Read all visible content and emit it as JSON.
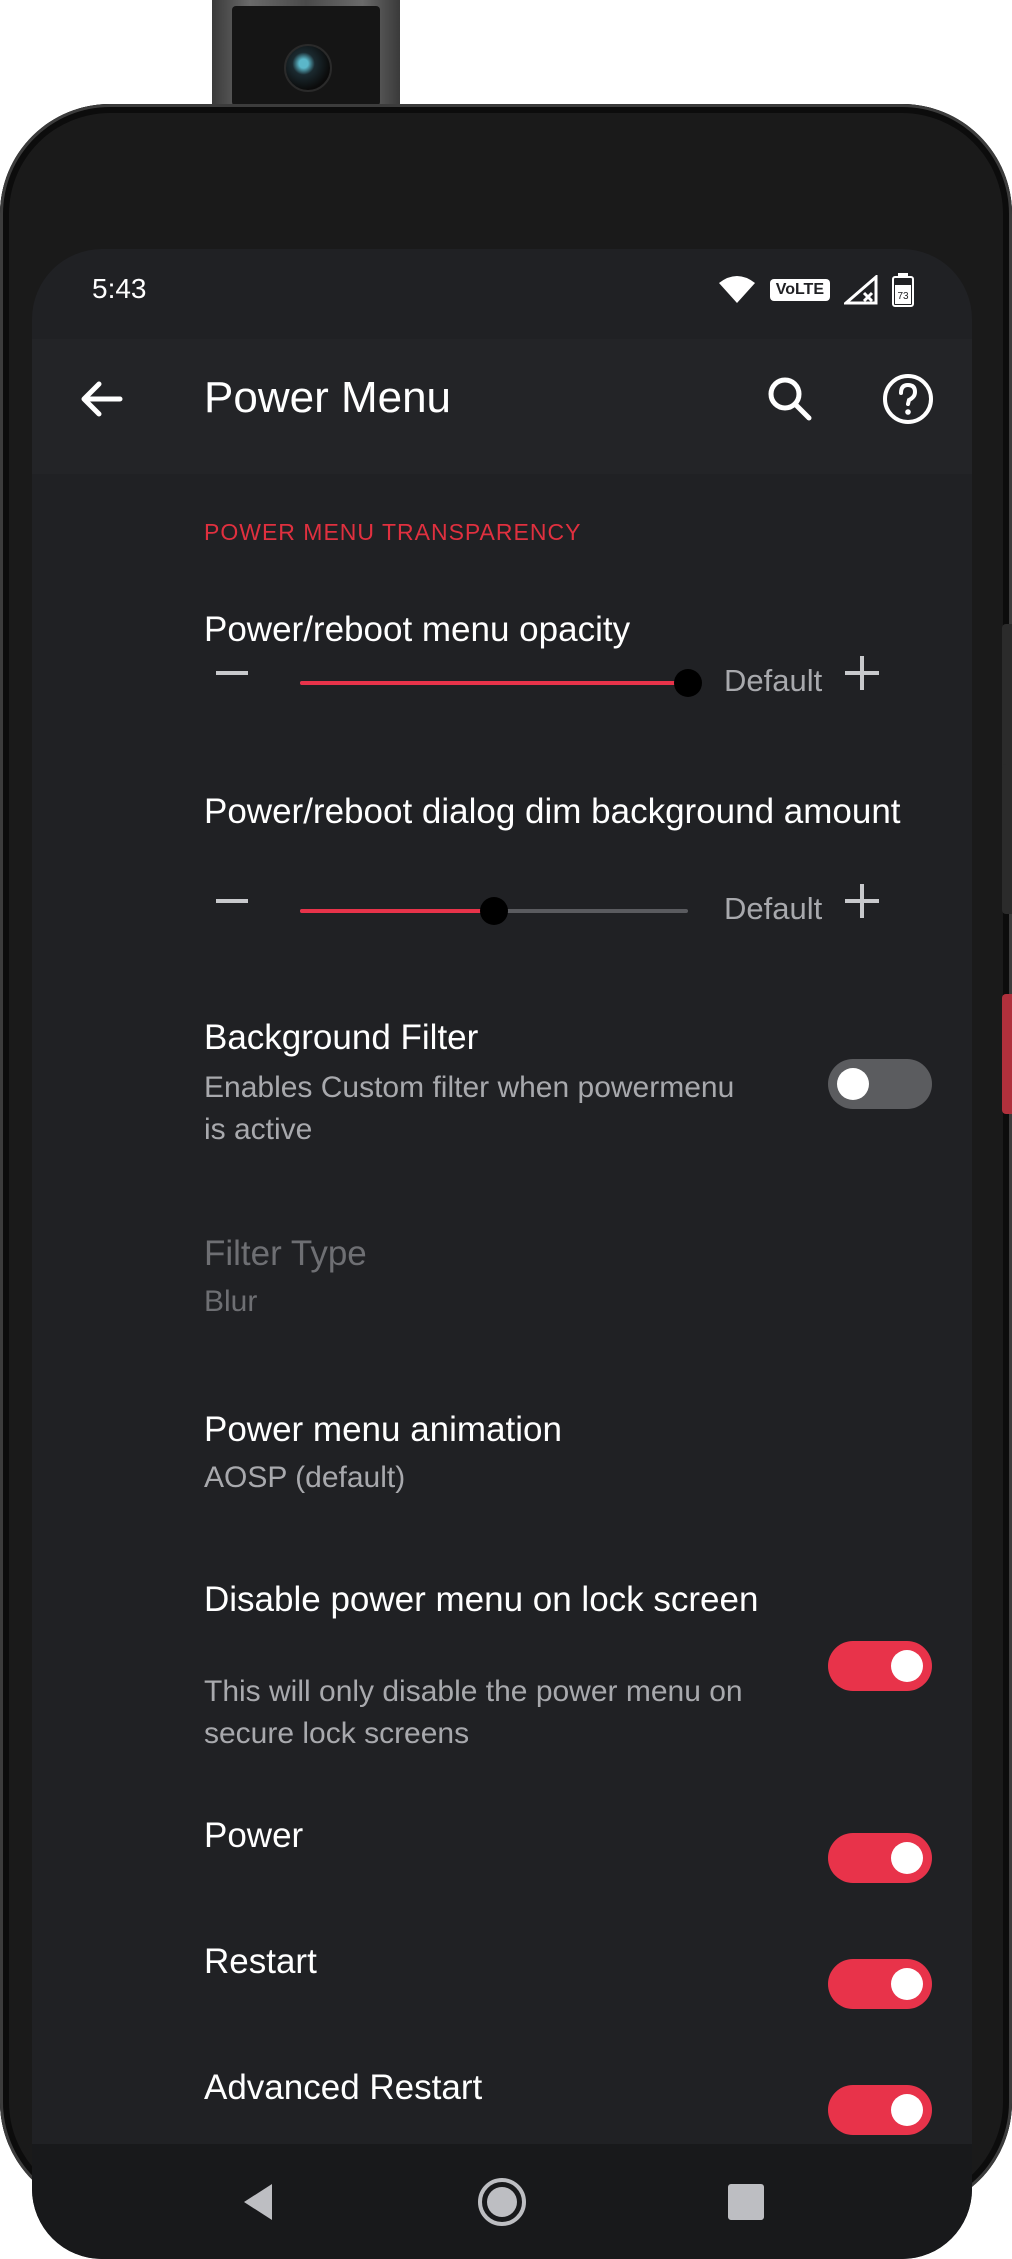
{
  "status_bar": {
    "time": "5:43",
    "volte": "VoLTE",
    "battery": "73"
  },
  "app_bar": {
    "title": "Power Menu",
    "icons": [
      "back-arrow-icon",
      "search-icon",
      "help-icon"
    ]
  },
  "section": {
    "header": "POWER MENU TRANSPARENCY"
  },
  "preferences": {
    "opacity": {
      "title": "Power/reboot menu opacity",
      "default_label": "Default",
      "value_fraction": 1.0
    },
    "dim": {
      "title": "Power/reboot dialog dim background amount",
      "default_label": "Default",
      "value_fraction": 0.5
    },
    "background_filter": {
      "title": "Background Filter",
      "summary": "Enables Custom filter when powermenu is active",
      "enabled": false
    },
    "filter_type": {
      "title": "Filter Type",
      "summary": "Blur",
      "disabled": true
    },
    "animation": {
      "title": "Power menu animation",
      "summary": "AOSP (default)"
    },
    "disable_on_lock": {
      "title": "Disable power menu on lock screen",
      "summary": "This will only disable the power menu on secure lock screens",
      "enabled": true
    },
    "power": {
      "title": "Power",
      "enabled": true
    },
    "restart": {
      "title": "Restart",
      "enabled": true
    },
    "advanced_restart": {
      "title": "Advanced Restart",
      "enabled": true
    }
  },
  "colors": {
    "accent": "#e8334a",
    "background": "#202124",
    "toggle_off": "#5b5c5f"
  },
  "nav_bar": {
    "icons": [
      "back-triangle-icon",
      "home-circle-icon",
      "recents-square-icon"
    ]
  }
}
